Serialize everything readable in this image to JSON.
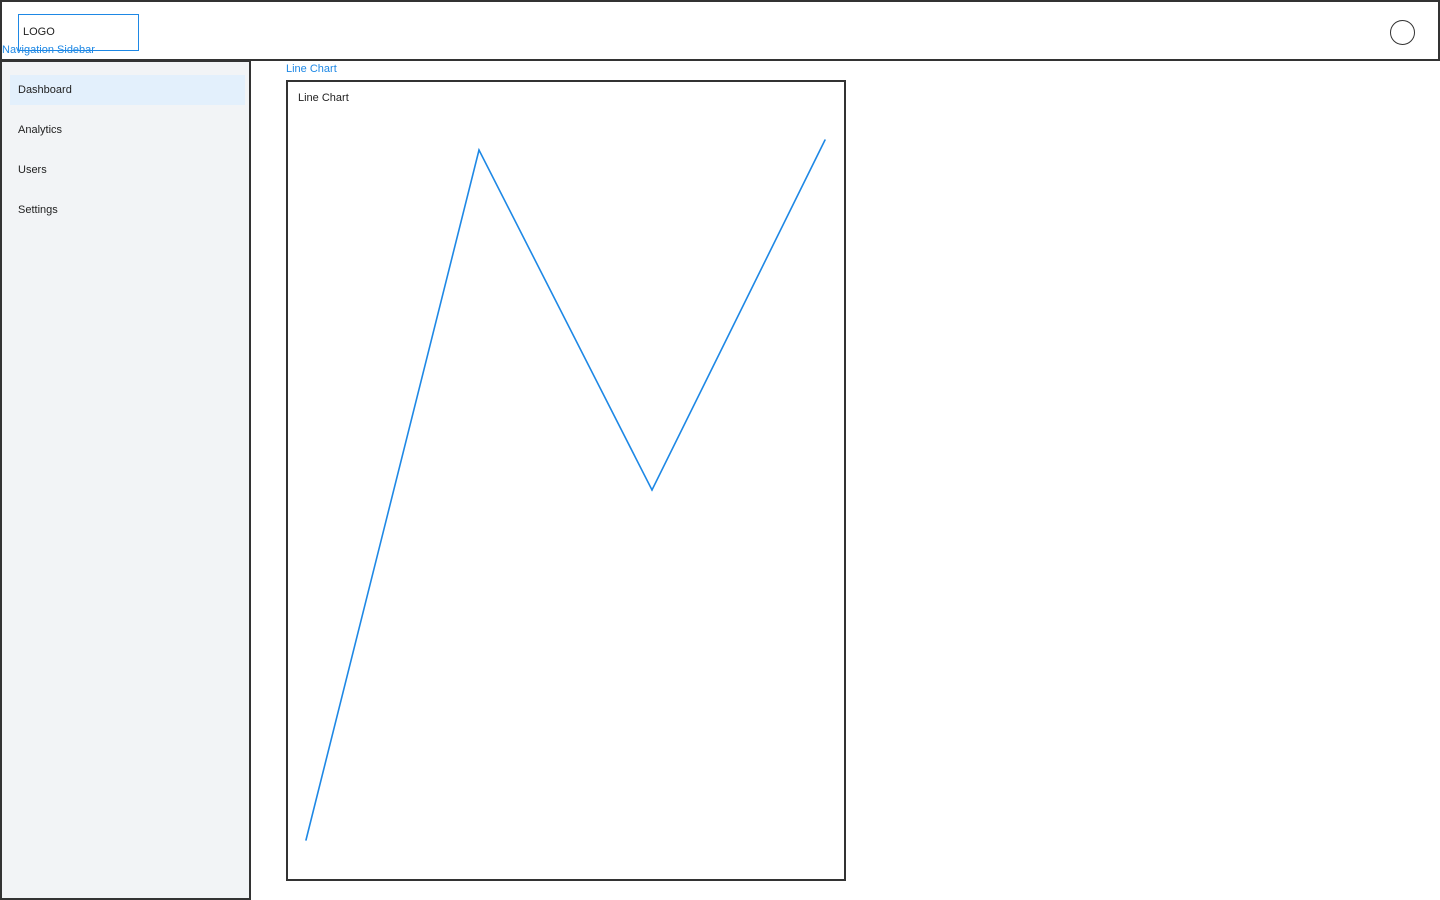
{
  "header": {
    "logo_text": "LOGO",
    "sidebar_label": "Navigation Sidebar"
  },
  "sidebar": {
    "items": [
      {
        "label": "Dashboard",
        "active": true
      },
      {
        "label": "Analytics",
        "active": false
      },
      {
        "label": "Users",
        "active": false
      },
      {
        "label": "Settings",
        "active": false
      }
    ]
  },
  "main": {
    "section_label": "Line Chart"
  },
  "chart_data": {
    "type": "line",
    "title": "Line Chart",
    "xlabel": "",
    "ylabel": "",
    "x": [
      0,
      1,
      2,
      3
    ],
    "series": [
      {
        "values": [
          0,
          69,
          35,
          70
        ],
        "color": "#1e88e5"
      }
    ],
    "ylim": [
      0,
      70
    ],
    "grid": false,
    "axes_visible": false
  },
  "colors": {
    "accent": "#1e88e5",
    "active_nav_bg": "#e3f0fc",
    "sidebar_bg": "#f2f4f6",
    "border": "#333333"
  }
}
